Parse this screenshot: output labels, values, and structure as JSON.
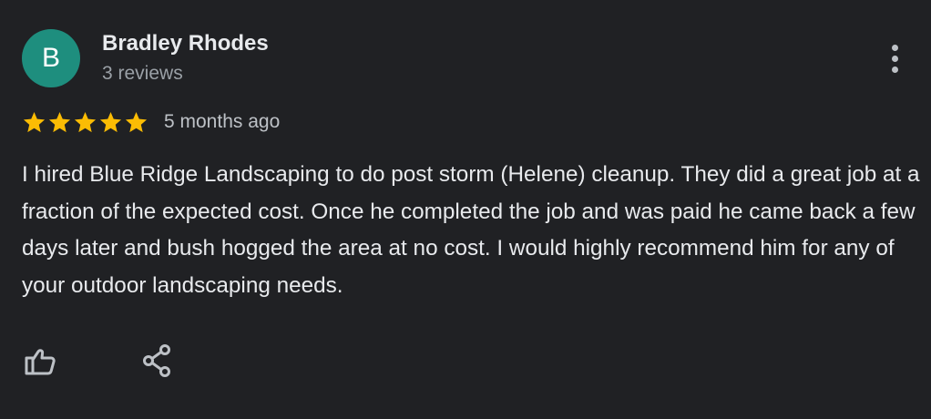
{
  "reviewer": {
    "avatar_letter": "B",
    "avatar_color": "#1e8e7e",
    "name": "Bradley Rhodes",
    "review_count": "3 reviews"
  },
  "rating": {
    "stars": 5,
    "max_stars": 5,
    "star_color": "#fbbc04",
    "time_ago": "5 months ago"
  },
  "review": {
    "text": "I hired Blue Ridge Landscaping to do post storm (Helene) cleanup. They did a great job at a fraction of the expected cost. Once he completed the job and was paid he came back a few days later and bush hogged the area at no cost. I would highly recommend him for any of your outdoor landscaping needs."
  },
  "actions": {
    "more_icon": "more-vert-icon",
    "like_icon": "thumb-up-icon",
    "share_icon": "share-icon"
  }
}
